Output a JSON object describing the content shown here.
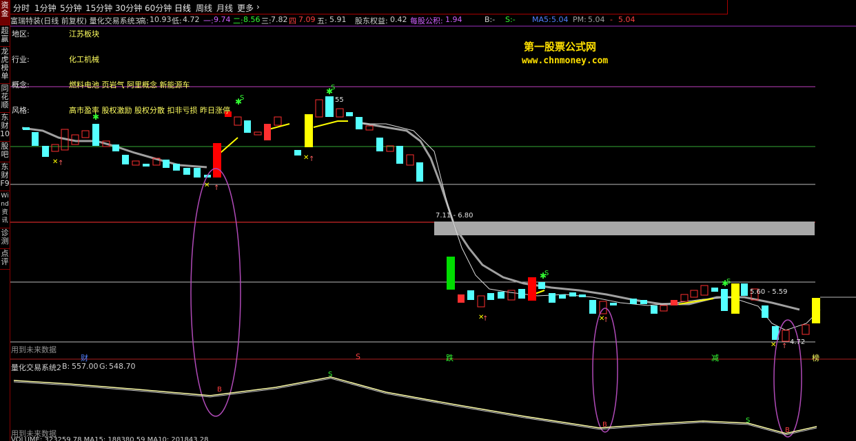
{
  "sidebar": {
    "tabs": [
      {
        "label": "资金",
        "active": true
      },
      {
        "label": "超赢",
        "active": false
      },
      {
        "label": "龙虎榜单",
        "active": false
      },
      {
        "label": "同花顺",
        "active": false
      },
      {
        "label": "东财10",
        "active": false
      },
      {
        "label": "股吧",
        "active": false
      },
      {
        "label": "东财F9",
        "active": false
      },
      {
        "label": "Wind资讯",
        "active": false
      },
      {
        "label": "诊测",
        "active": false
      },
      {
        "label": "点评",
        "active": false
      }
    ]
  },
  "periods": {
    "items": [
      "分时",
      "1分钟",
      "5分钟",
      "15分钟",
      "30分钟",
      "60分钟",
      "日线",
      "周线",
      "月线",
      "更多",
      "›"
    ],
    "active": "日线"
  },
  "infobar": {
    "title": "富瑞特装(日线 前复权) 量化交易系统3",
    "high_label": "高:",
    "high": "10.93",
    "low_label": "低:",
    "low": "4.72",
    "v1_label": "一:",
    "v1": "9.74",
    "v2_label": "二:",
    "v2": "8.56",
    "v3_label": "三:",
    "v3": "7.82",
    "v4_label": "四",
    "v4": "7.09",
    "v5_label": "五:",
    "v5": "5.91",
    "equity_label": "股东权益:",
    "equity": "0.42",
    "fund_label": "每股公积:",
    "fund": "1.94",
    "b_label": "B:-",
    "s_label": "S:-",
    "ma_label": "MA5:",
    "ma": "5.04",
    "pm_label": "PM:",
    "pm": "5.04",
    "last_label": "-",
    "last": "5.04"
  },
  "stock_info": {
    "region_label": "地区:",
    "region": "江苏板块",
    "industry_label": "行业:",
    "industry": "化工机械",
    "concept_label": "概念:",
    "concept": "燃料电池 页岩气 阿里概念 新能源车",
    "style_label": "风格:",
    "style": "高市盈率 股权激励 股权分散 扣非亏损 昨日涨停"
  },
  "watermark": {
    "name": "第一股票公式网",
    "url": "www.chnmoney.com"
  },
  "annotations": {
    "top_box": "7.11 - 6.80",
    "right_box": "5.60 - 5.59",
    "right_low": "4.72",
    "peak": "55"
  },
  "footer": {
    "future_note": "用到未来数据",
    "tags": [
      "财",
      "S",
      "跌",
      "减",
      "榜"
    ],
    "indicator_title": "量化交易系统2",
    "ind_b_label": "B:",
    "ind_b": "557.00",
    "ind_g_label": "G:",
    "ind_g": "548.70",
    "future_note2": "用到未来数据",
    "volume_text": "VOLUME: 323259.78  MA15: 188380.59  MA10: 201843.28"
  },
  "colors": {
    "up": "#ff3030",
    "down": "#54ffff",
    "limit_up": "#ff0000",
    "ma": "#a0a0a0",
    "signal": "#ffff00",
    "ellipse": "#b04ab8",
    "watermark": "#ffe000",
    "grid": "#cc3333"
  },
  "chart_data": {
    "type": "candlestick",
    "price_range": [
      4.72,
      10.93
    ],
    "overlay_levels": {
      "一": 9.74,
      "二": 8.56,
      "三": 7.82,
      "四": 7.09,
      "五": 5.91
    },
    "ma5_last": 5.04
  }
}
